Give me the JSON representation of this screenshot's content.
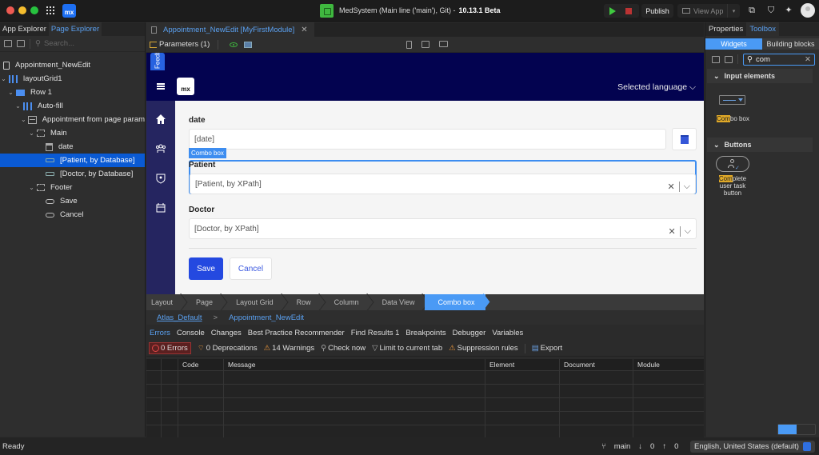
{
  "titlebar": {
    "app_title": "MedSystem (Main line ('main'), Git) -",
    "version": "10.13.1 Beta",
    "publish_label": "Publish",
    "view_app_label": "View App",
    "logo_text": "mx"
  },
  "left_panel": {
    "tabs": [
      {
        "label": "App Explorer",
        "active": false
      },
      {
        "label": "Page Explorer",
        "active": true
      }
    ],
    "search_placeholder": "Search...",
    "tree": [
      {
        "label": "Appointment_NewEdit",
        "icon": "page-icon",
        "depth": 0,
        "expander": false
      },
      {
        "label": "layoutGrid1",
        "icon": "layout-grid-icon",
        "depth": 0,
        "expander": true
      },
      {
        "label": "Row 1",
        "icon": "row-icon",
        "depth": 1,
        "expander": true
      },
      {
        "label": "Auto-fill",
        "icon": "column-icon",
        "depth": 2,
        "expander": true
      },
      {
        "label": "Appointment from page param",
        "icon": "data-view-icon",
        "depth": 3,
        "expander": true
      },
      {
        "label": "Main",
        "icon": "container-icon",
        "depth": 4,
        "expander": true
      },
      {
        "label": "date",
        "icon": "date-picker-icon",
        "depth": 5,
        "expander": false
      },
      {
        "label": "[Patient, by Database]",
        "icon": "combo-box-icon",
        "depth": 5,
        "expander": false,
        "selected": true
      },
      {
        "label": "[Doctor, by Database]",
        "icon": "combo-box-icon",
        "depth": 5,
        "expander": false
      },
      {
        "label": "Footer",
        "icon": "container-icon",
        "depth": 4,
        "expander": true
      },
      {
        "label": "Save",
        "icon": "button-icon",
        "depth": 5,
        "expander": false
      },
      {
        "label": "Cancel",
        "icon": "button-icon",
        "depth": 5,
        "expander": false
      }
    ]
  },
  "editor": {
    "doc_tab": "Appointment_NewEdit [MyFirstModule]",
    "parameters_label": "Parameters (1)",
    "feedback_label": "Feedback",
    "logo_text": "mx",
    "language_label": "Selected language",
    "form": {
      "date_label": "date",
      "date_value": "[date]",
      "selection_tag": "Combo box",
      "patient_label": "Patient",
      "patient_value": "[Patient, by XPath]",
      "doctor_label": "Doctor",
      "doctor_value": "[Doctor, by XPath]",
      "save_label": "Save",
      "cancel_label": "Cancel"
    },
    "breadcrumbs": [
      "Layout",
      "Page",
      "Layout Grid",
      "Row",
      "Column",
      "Data View",
      "Combo box"
    ],
    "path": {
      "layout_link": "Atlas_Default",
      "separator": ">",
      "page": "Appointment_NewEdit"
    }
  },
  "bottom_panel": {
    "tabs": [
      {
        "label": "Errors",
        "active": true
      },
      {
        "label": "Console"
      },
      {
        "label": "Changes"
      },
      {
        "label": "Best Practice Recommender"
      },
      {
        "label": "Find Results 1"
      },
      {
        "label": "Breakpoints"
      },
      {
        "label": "Debugger"
      },
      {
        "label": "Variables"
      }
    ],
    "toolbar": {
      "errors": "0 Errors",
      "deprecations": "0 Deprecations",
      "warnings": "14 Warnings",
      "check_now": "Check now",
      "limit": "Limit to current tab",
      "suppression": "Suppression rules",
      "export": "Export"
    },
    "columns": [
      "",
      "",
      "Code",
      "Message",
      "Element",
      "Document",
      "Module"
    ],
    "rows": []
  },
  "right_panel": {
    "tabs": [
      {
        "label": "Properties",
        "active": false
      },
      {
        "label": "Toolbox",
        "active": true
      }
    ],
    "segments": [
      {
        "label": "Widgets",
        "active": true
      },
      {
        "label": "Building blocks",
        "active": false
      }
    ],
    "search_value": "com",
    "sections": [
      {
        "label": "Input elements",
        "items": [
          {
            "highlight": "Com",
            "rest": "bo box"
          }
        ]
      },
      {
        "label": "Buttons",
        "items": [
          {
            "highlight": "Com",
            "rest": "plete user task button"
          }
        ]
      }
    ]
  },
  "status_bar": {
    "status": "Ready",
    "branch": "main",
    "incoming": "0",
    "outgoing": "0",
    "locale": "English, United States (default)"
  }
}
